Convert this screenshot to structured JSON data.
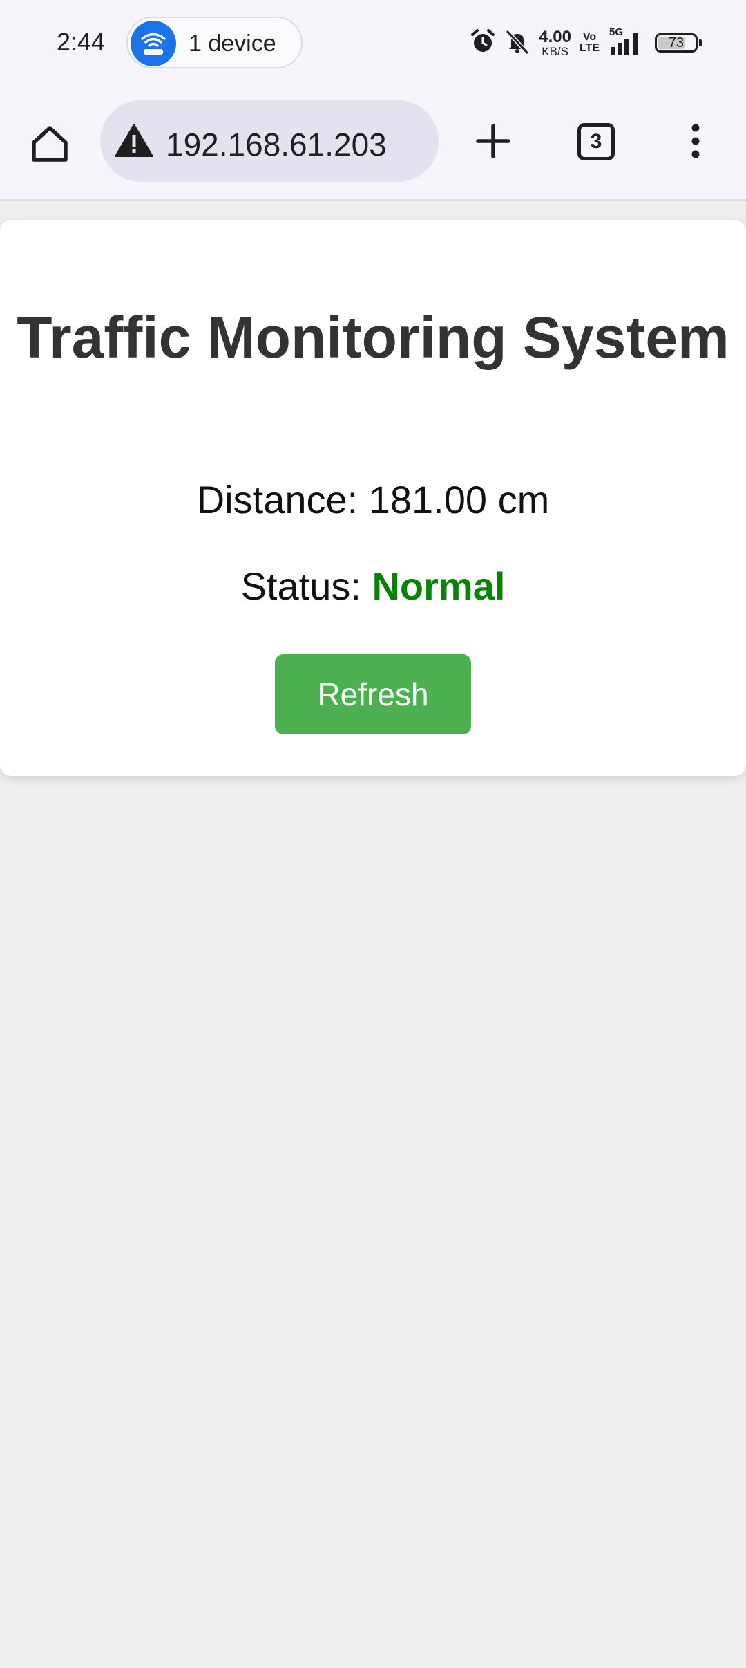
{
  "status_bar": {
    "time": "2:44",
    "hotspot_label": "1 device",
    "net_speed_value": "4.00",
    "net_speed_unit": "KB/S",
    "volte_top": "Vo",
    "volte_bottom": "LTE",
    "network_type": "5G",
    "battery_level": "73",
    "icons": [
      "hotspot-wifi-icon",
      "alarm-icon",
      "bell-muted-icon",
      "signal-icon",
      "battery-icon"
    ]
  },
  "browser": {
    "url": "192.168.61.203",
    "tab_count": "3",
    "icons": [
      "home-icon",
      "warning-icon",
      "plus-icon",
      "tabs-icon",
      "more-vert-icon"
    ]
  },
  "page": {
    "title": "Traffic Monitoring System",
    "distance_text": "Distance: 181.00 cm",
    "status_prefix": "Status:",
    "status_value": "Normal",
    "refresh_label": "Refresh"
  },
  "colors": {
    "status_normal": "#0a820a",
    "refresh_button": "#4caf50",
    "hotspot_accent": "#1a73e8"
  }
}
